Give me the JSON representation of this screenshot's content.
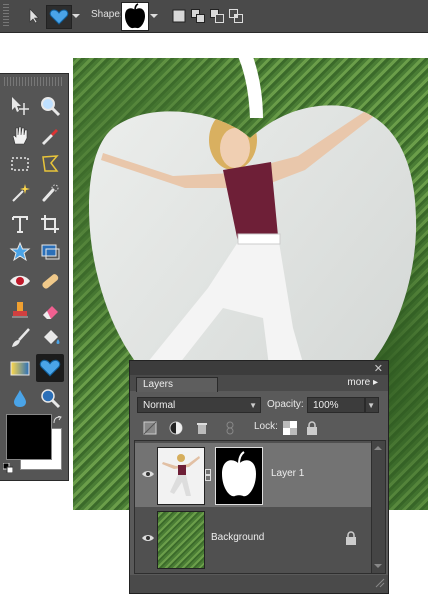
{
  "options_bar": {
    "shape_label": "Shape:",
    "tool_icon": "custom-shape-tool-icon",
    "shape_icon": "apple-shape-icon",
    "mode_icons": [
      "create-new-shape-icon",
      "add-to-shape-icon",
      "subtract-shape-icon",
      "intersect-shape-icon"
    ]
  },
  "toolbox": {
    "tools": [
      "move-tool-icon",
      "zoom-tool-icon",
      "hand-tool-icon",
      "eyedropper-tool-icon",
      "marquee-tool-icon",
      "lasso-tool-icon",
      "magic-wand-tool-icon",
      "quick-selection-tool-icon",
      "type-tool-icon",
      "crop-tool-icon",
      "cookie-cutter-tool-icon",
      "recompose-tool-icon",
      "red-eye-tool-icon",
      "spot-healing-tool-icon",
      "clone-stamp-tool-icon",
      "eraser-tool-icon",
      "brush-tool-icon",
      "paint-bucket-tool-icon",
      "gradient-tool-icon",
      "custom-shape-tool-icon",
      "blur-tool-icon",
      "sponge-tool-icon"
    ],
    "active_tool": "custom-shape-tool-icon",
    "foreground_color": "#000000",
    "background_color": "#ffffff"
  },
  "layers_panel": {
    "tab_label": "Layers",
    "more_label": "more ▸",
    "blend_mode": "Normal",
    "opacity_label": "Opacity:",
    "opacity_value": "100%",
    "lock_label": "Lock:",
    "layers": [
      {
        "name": "Layer 1",
        "selected": true,
        "visible": true,
        "locked": false
      },
      {
        "name": "Background",
        "selected": false,
        "visible": true,
        "locked": true
      }
    ]
  },
  "colors": {
    "ui_panel": "#5a5a5a",
    "ui_dark": "#3c3c3c",
    "highlight": "#737373",
    "accent_blue": "#2b8fd6"
  }
}
